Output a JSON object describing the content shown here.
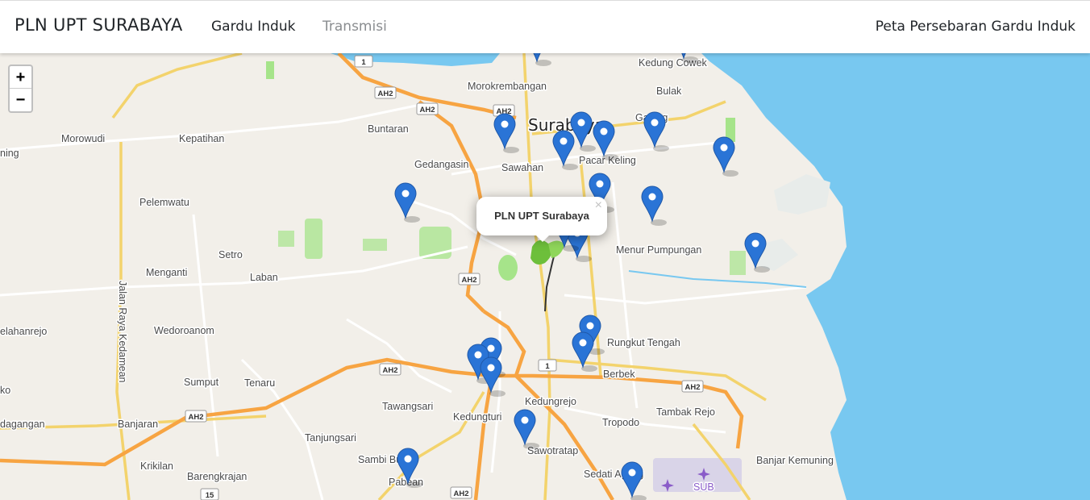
{
  "navbar": {
    "brand": "PLN UPT SURABAYA",
    "links": [
      {
        "label": "Gardu Induk",
        "active": true
      },
      {
        "label": "Transmisi",
        "active": false
      }
    ],
    "right_title": "Peta Persebaran Gardu Induk"
  },
  "zoom": {
    "in_label": "+",
    "out_label": "−"
  },
  "popup": {
    "text": "PLN UPT Surabaya",
    "close_label": "×"
  },
  "map": {
    "colors": {
      "land": "#f2efe9",
      "water": "#78c8f0",
      "highway": "#f7a442",
      "primary_road": "#f3d36c",
      "park": "#a6e48a",
      "marker": "#2a74d6"
    },
    "city_label": "Surabaya",
    "place_labels": [
      "Kedung Cowek",
      "Morokrembangan",
      "Bulak",
      "Buntaran",
      "Morowudi",
      "Kepatihan",
      "Gading",
      "Gedangasin",
      "Sawahan",
      "Pacar Keling",
      "Pelemwatu",
      "Setro",
      "Menur Pumpungan",
      "Menganti",
      "Laban",
      "Jalan Raya Kedamean",
      "Wedoroanom",
      "Rungkut Tengah",
      "Berbek",
      "Sumput",
      "Tenaru",
      "Kedungrejo",
      "Tawangsari",
      "Tambak Rejo",
      "Kedungturi",
      "Tropodo",
      "Banjaran",
      "Tanjungsari",
      "Sawotratap",
      "Krikilan",
      "Sambi Bulu",
      "Banjar Kemuning",
      "Barengkrajan",
      "Pabean",
      "Sedati Agung",
      "SUB",
      "ning",
      "elahanrejo",
      "ko",
      "dagangan"
    ],
    "road_shields": [
      "1",
      "AH2",
      "AH2",
      "AH2",
      "AH2",
      "AH2",
      "1",
      "AH2",
      "AH2",
      "15",
      "AH2"
    ],
    "marker_count": 22
  }
}
